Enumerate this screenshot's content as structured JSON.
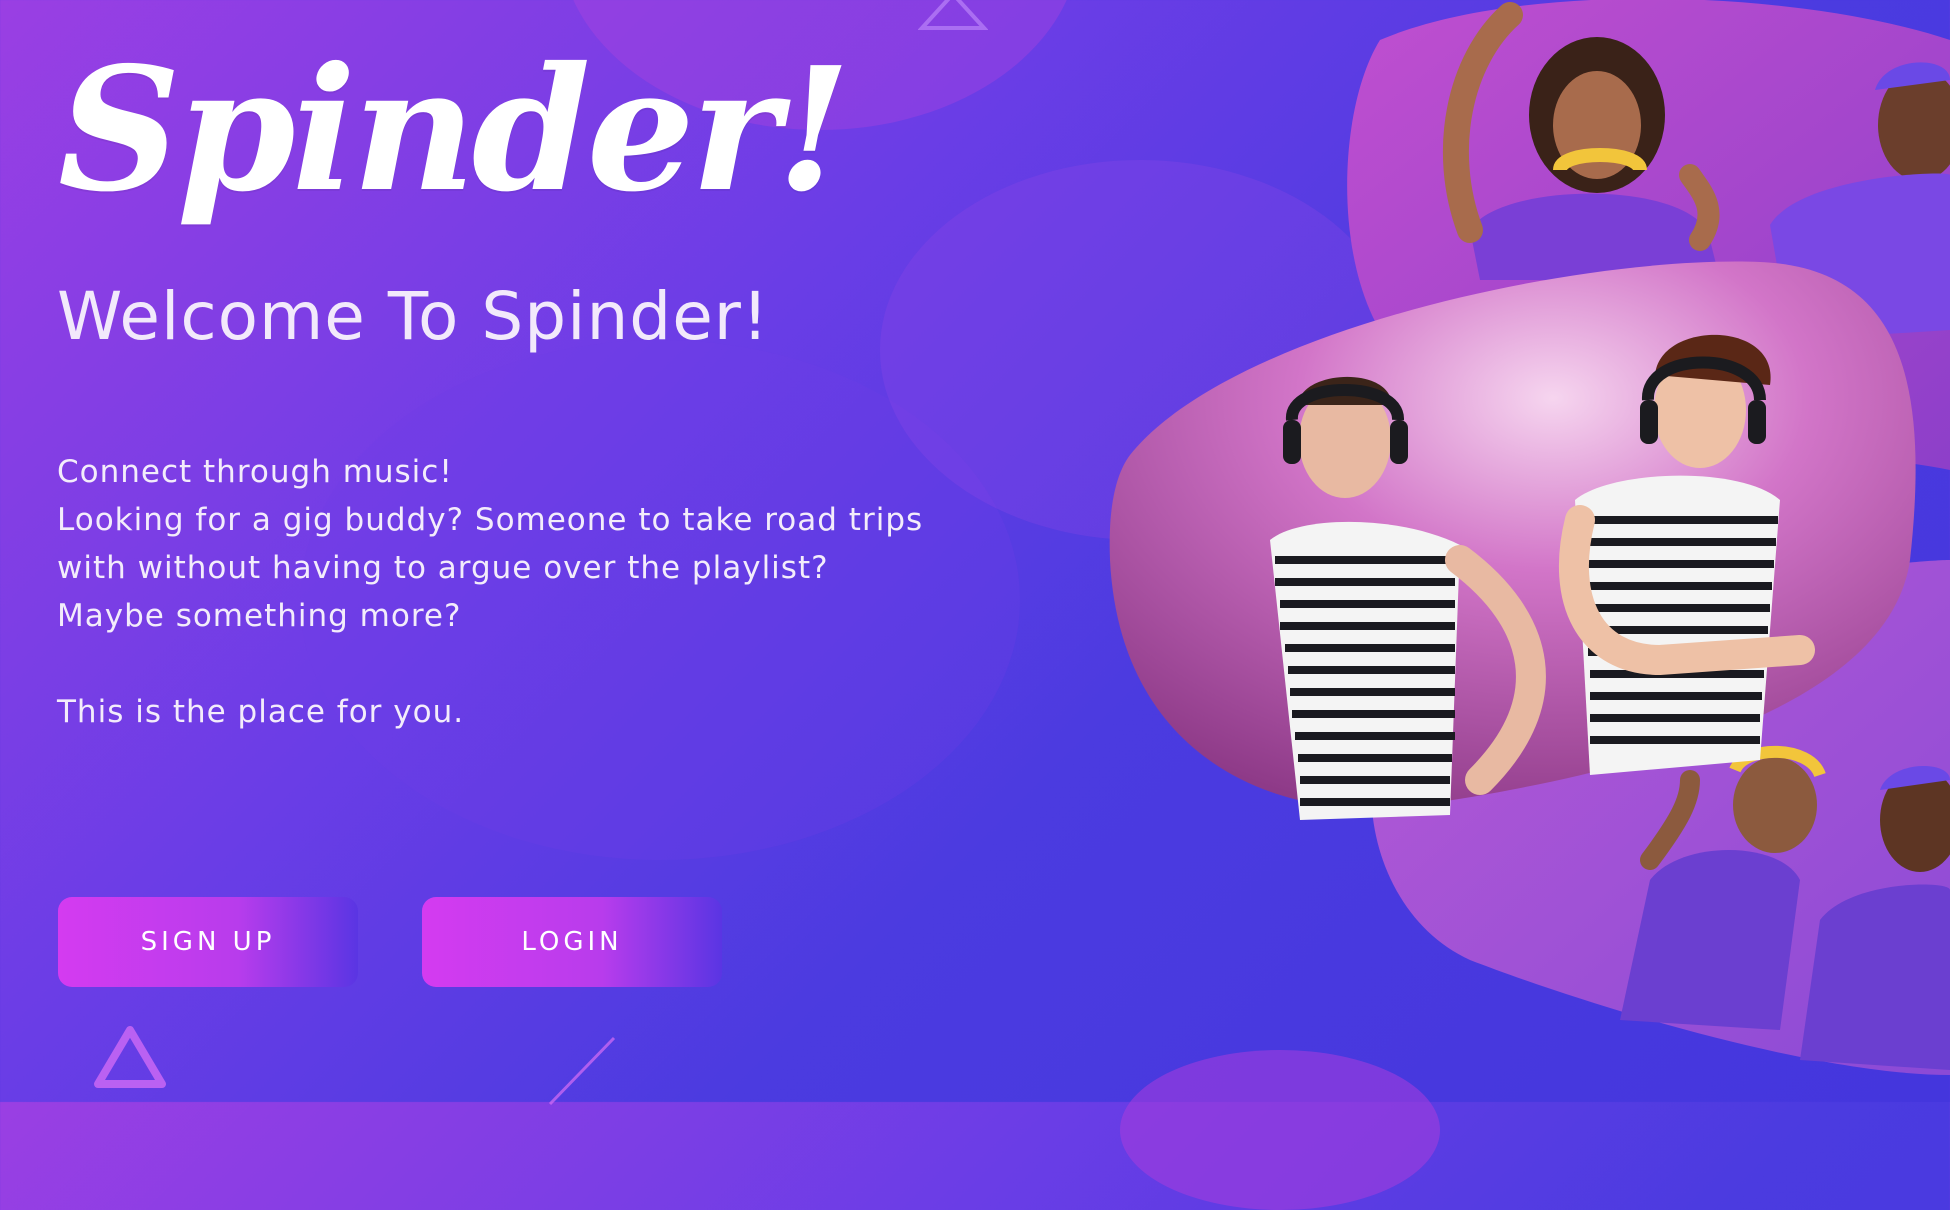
{
  "app": {
    "logo_text": "Spinder!",
    "welcome_title": "Welcome To Spinder!"
  },
  "intro": {
    "lines": [
      "Connect through music!",
      "Looking for a gig buddy? Someone to take road trips",
      "with without having to argue over the playlist?",
      "Maybe something more?"
    ],
    "closing": "This is the place for you."
  },
  "buttons": {
    "signup_label": "SIGN UP",
    "login_label": "LOGIN"
  },
  "colors": {
    "background_start": "#9a3fe3",
    "background_end": "#4436dd",
    "button_start": "#d43bf0",
    "button_end": "#5a35e3",
    "text": "#ffffff"
  }
}
